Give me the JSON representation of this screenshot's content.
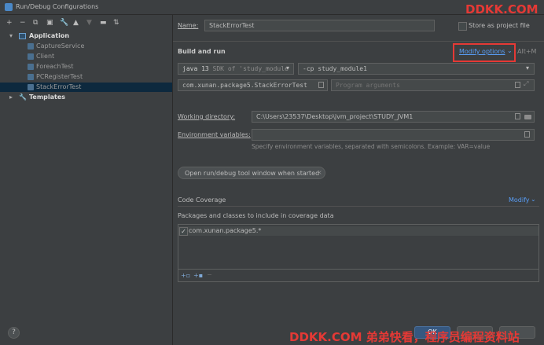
{
  "window": {
    "title": "Run/Debug Configurations"
  },
  "watermark_top": "DDKK.COM",
  "watermark_bottom": "DDKK.COM 弟弟快看，程序员编程资料站",
  "toolbar": {
    "icons": [
      "plus-icon",
      "minus-icon",
      "copy-icon",
      "save-icon",
      "wrench-icon",
      "arrow-up-icon",
      "arrow-down-icon",
      "folder-icon",
      "sort-icon"
    ],
    "glyphs": [
      "+",
      "−",
      "⧉",
      "▣",
      "🔧",
      "▲",
      "▼",
      "▬",
      "⇅"
    ]
  },
  "tree": {
    "application": "Application",
    "items": [
      "CaptureService",
      "Client",
      "ForeachTest",
      "PCRegisterTest",
      "StackErrorTest"
    ],
    "selected": "StackErrorTest",
    "templates": "Templates"
  },
  "form": {
    "name_label": "Name:",
    "name_value": "StackErrorTest",
    "store_label": "Store as project file",
    "build_run_label": "Build and run",
    "modify_options": "Modify options",
    "modify_shortcut": "Alt+M",
    "sdk_value": "java 13",
    "sdk_hint": "SDK of 'study_module",
    "cp_value": "-cp study_module1",
    "main_class": "com.xunan.package5.StackErrorTest",
    "program_args_placeholder": "Program arguments",
    "working_dir_label": "Working directory:",
    "working_dir_value": "C:\\Users\\23537\\Desktop\\jvm_project\\STUDY_JVM1",
    "env_vars_label": "Environment variables:",
    "env_hint": "Specify environment variables, separated with semicolons. Example: VAR=value",
    "tool_window_chip": "Open run/debug tool window when started",
    "code_coverage_label": "Code Coverage",
    "coverage_modify": "Modify",
    "packages_label": "Packages and classes to include in coverage data",
    "package_entry": "com.xunan.package5.*"
  },
  "buttons": {
    "ok": "OK",
    "help": "?"
  },
  "colors": {
    "accent": "#589df6",
    "highlight": "#e53935",
    "selection": "#0d293e"
  }
}
